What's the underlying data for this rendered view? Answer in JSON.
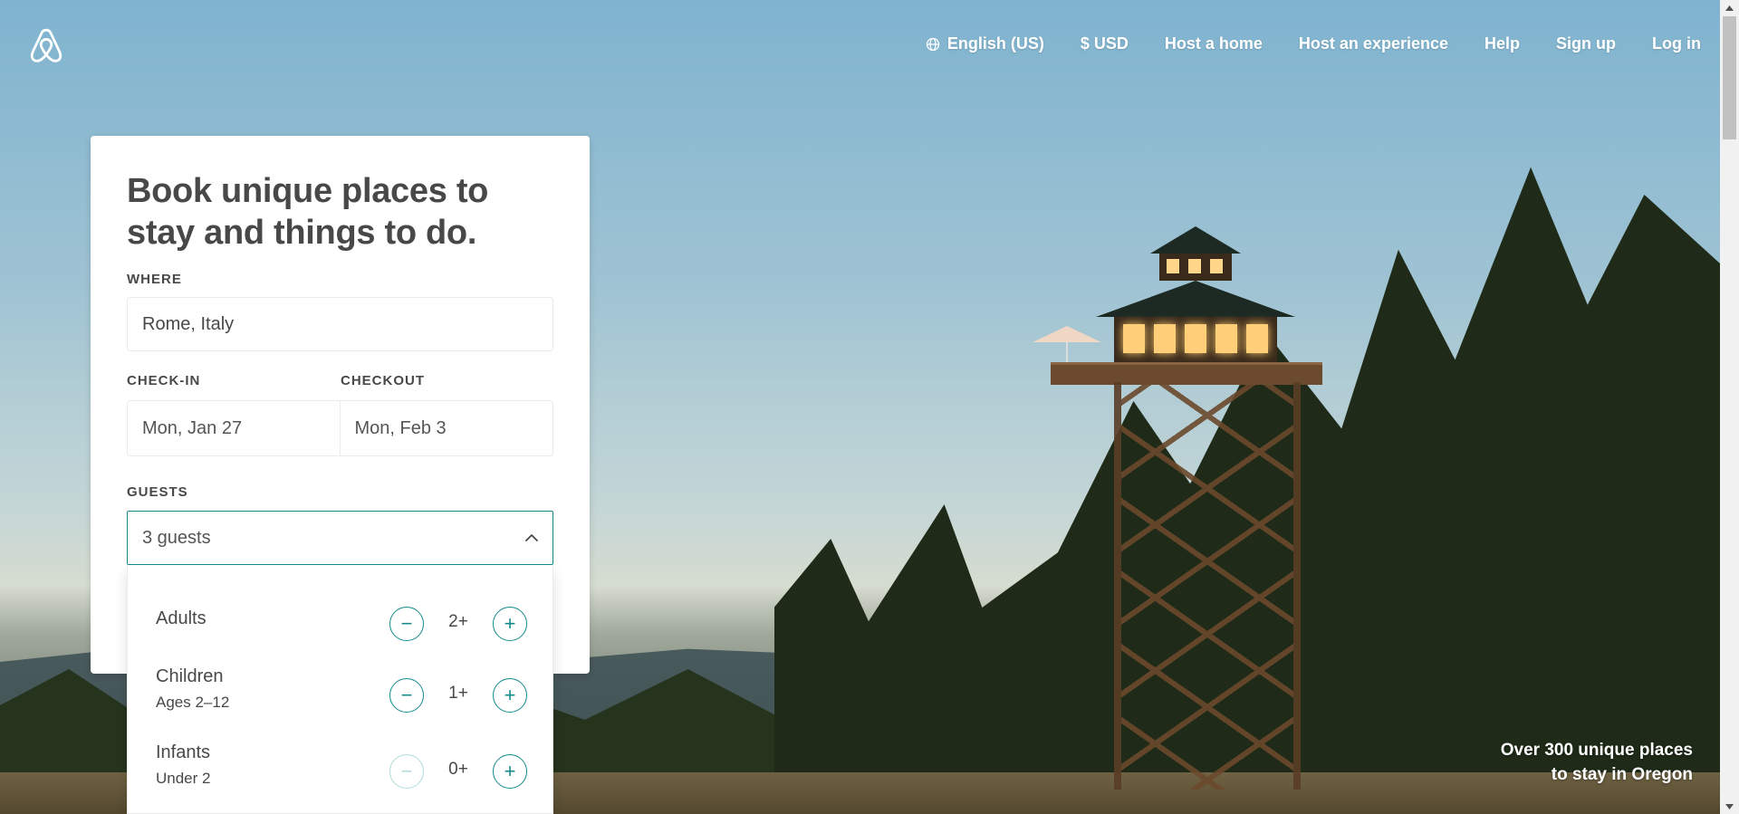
{
  "nav": {
    "language": "English (US)",
    "currency": "$ USD",
    "host_home": "Host a home",
    "host_experience": "Host an experience",
    "help": "Help",
    "signup": "Sign up",
    "login": "Log in"
  },
  "search_card": {
    "title": "Book unique places to stay and things to do.",
    "where_label": "WHERE",
    "where_value": "Rome, Italy",
    "checkin_label": "CHECK-IN",
    "checkin_value": "Mon, Jan 27",
    "checkout_label": "CHECKOUT",
    "checkout_value": "Mon, Feb 3",
    "guests_label": "GUESTS",
    "guests_value": "3 guests"
  },
  "guests_dropdown": {
    "rows": [
      {
        "name": "Adults",
        "sub": "",
        "value": "2+",
        "minus_enabled": true
      },
      {
        "name": "Children",
        "sub": "Ages 2–12",
        "value": "1+",
        "minus_enabled": true
      },
      {
        "name": "Infants",
        "sub": "Under 2",
        "value": "0+",
        "minus_enabled": false
      }
    ],
    "minus_symbol": "−",
    "plus_symbol": "+"
  },
  "caption": {
    "line1": "Over 300 unique places",
    "line2": "to stay in Oregon"
  },
  "colors": {
    "accent_teal": "#148a8a",
    "text": "#484848"
  },
  "icons": [
    "airbnb-logo",
    "globe-icon",
    "chevron-up-icon",
    "scroll-up-arrow",
    "scroll-down-arrow"
  ]
}
